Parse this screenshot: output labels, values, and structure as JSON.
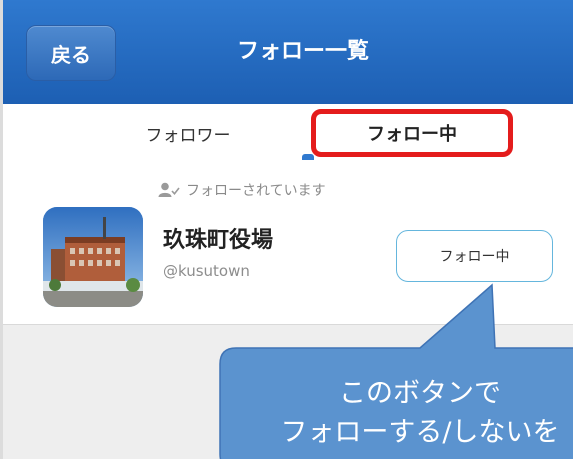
{
  "header": {
    "back_label": "戻る",
    "title": "フォロー一覧"
  },
  "tabs": [
    {
      "label": "フォロワー"
    },
    {
      "label": "フォロー中"
    }
  ],
  "users": [
    {
      "follow_status": "フォローされています",
      "name": "玖珠町役場",
      "handle": "@kusutown",
      "button_label": "フォロー中"
    }
  ],
  "annotation": {
    "line1": "このボタンで",
    "line2": "フォローする/しないを"
  },
  "colors": {
    "header": "#2f79cf",
    "highlight": "#e41c1c",
    "button_border": "#65b6dd",
    "callout": "#5b93cf"
  }
}
